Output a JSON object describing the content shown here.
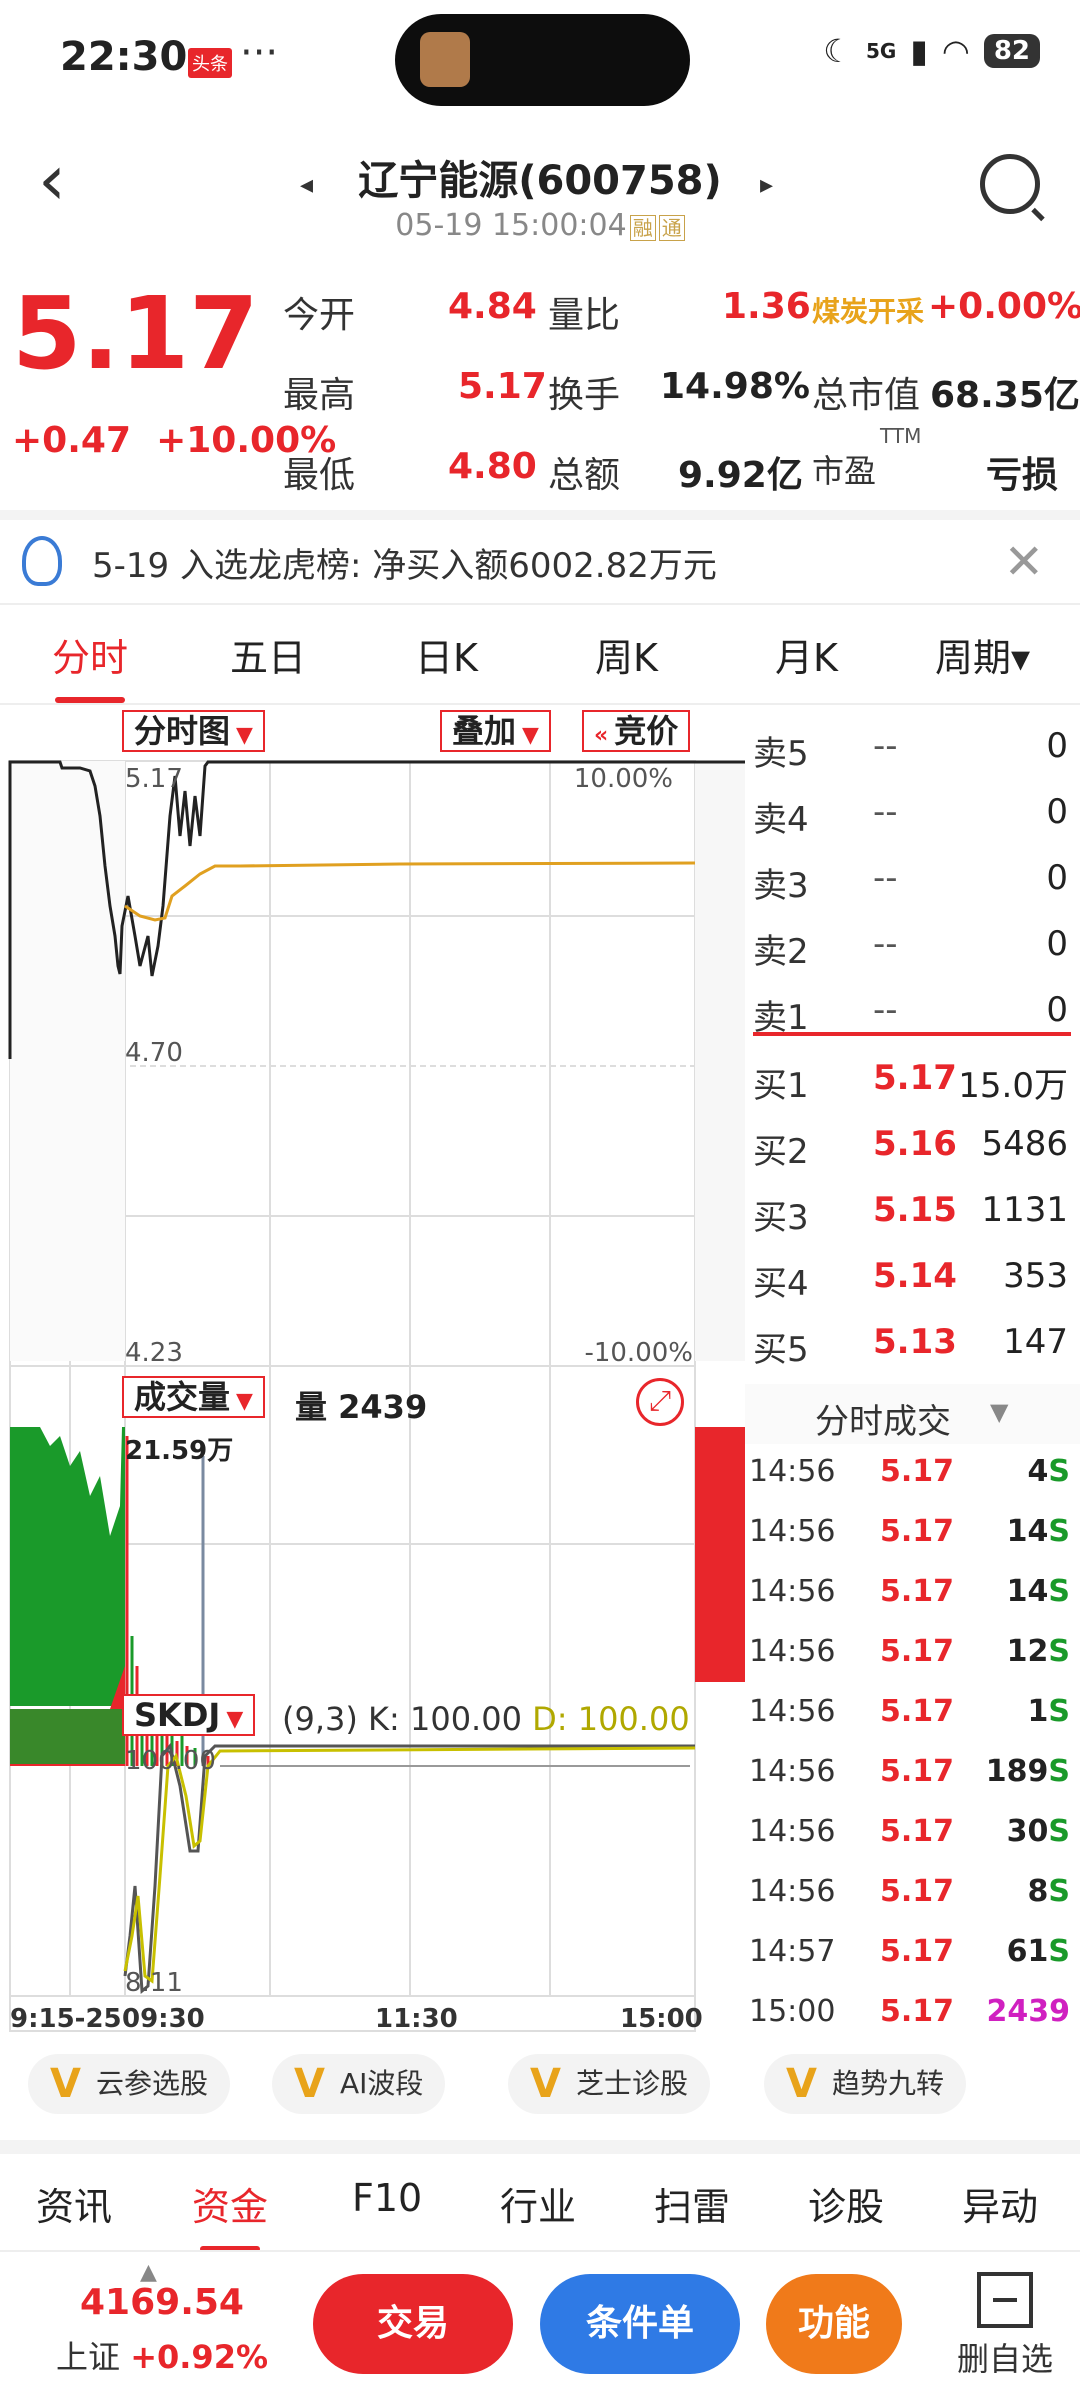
{
  "status_bar": {
    "time": "22:30",
    "badge": "头条",
    "dots": "···",
    "network": "5G",
    "battery": "82"
  },
  "header": {
    "title": "辽宁能源(600758)",
    "subtitle": "05-19 15:00:04",
    "tag1": "融",
    "tag2": "通"
  },
  "quote": {
    "price": "5.17",
    "change": "+0.47",
    "change_pct": "+10.00%",
    "rows": [
      [
        {
          "label": "今开",
          "value": "4.84"
        },
        {
          "label": "量比",
          "value": "1.36"
        },
        {
          "label": "煤炭开采",
          "value": "+0.00%"
        }
      ],
      [
        {
          "label": "最高",
          "value": "5.17"
        },
        {
          "label": "换手",
          "value": "14.98%"
        },
        {
          "label": "总市值",
          "value": "68.35亿"
        }
      ],
      [
        {
          "label": "最低",
          "value": "4.80"
        },
        {
          "label": "总额",
          "value": "9.92亿"
        },
        {
          "label": "市盈",
          "sup": "TTM",
          "value": "亏损"
        }
      ]
    ]
  },
  "notice": {
    "text": "5-19 入选龙虎榜: 净买入额6002.82万元"
  },
  "tabs": [
    "分时",
    "五日",
    "日K",
    "周K",
    "月K",
    "周期▾"
  ],
  "chart": {
    "dropdown_main": "分时图",
    "dropdown_overlay": "叠加",
    "auction": "竞价",
    "price_top": "5.17",
    "price_mid": "4.70",
    "price_bottom": "4.23",
    "pct_top": "10.00%",
    "pct_bottom": "-10.00%",
    "volume_dropdown": "成交量",
    "volume_label": "量 2439",
    "volume_max": "21.59万",
    "kdj_dropdown": "SKDJ",
    "kdj_params": "(9,3)",
    "kdj_k": "K: 100.00",
    "kdj_d": "D: 100.00",
    "kdj_top": "100.00",
    "kdj_bottom": "8.11",
    "time_labels": [
      "9:15-25",
      "09:30",
      "11:30",
      "15:00"
    ]
  },
  "order_book": {
    "sell": [
      {
        "label": "卖5",
        "price": "--",
        "vol": "0"
      },
      {
        "label": "卖4",
        "price": "--",
        "vol": "0"
      },
      {
        "label": "卖3",
        "price": "--",
        "vol": "0"
      },
      {
        "label": "卖2",
        "price": "--",
        "vol": "0"
      },
      {
        "label": "卖1",
        "price": "--",
        "vol": "0"
      }
    ],
    "buy": [
      {
        "label": "买1",
        "price": "5.17",
        "vol": "15.0万"
      },
      {
        "label": "买2",
        "price": "5.16",
        "vol": "5486"
      },
      {
        "label": "买3",
        "price": "5.15",
        "vol": "1131"
      },
      {
        "label": "买4",
        "price": "5.14",
        "vol": "353"
      },
      {
        "label": "买5",
        "price": "5.13",
        "vol": "147"
      }
    ]
  },
  "ticks": {
    "title": "分时成交",
    "rows": [
      {
        "time": "14:56",
        "price": "5.17",
        "vol": "4",
        "side": "S"
      },
      {
        "time": "14:56",
        "price": "5.17",
        "vol": "14",
        "side": "S"
      },
      {
        "time": "14:56",
        "price": "5.17",
        "vol": "14",
        "side": "S"
      },
      {
        "time": "14:56",
        "price": "5.17",
        "vol": "12",
        "side": "S"
      },
      {
        "time": "14:56",
        "price": "5.17",
        "vol": "1",
        "side": "S"
      },
      {
        "time": "14:56",
        "price": "5.17",
        "vol": "189",
        "side": "S"
      },
      {
        "time": "14:56",
        "price": "5.17",
        "vol": "30",
        "side": "S"
      },
      {
        "time": "14:56",
        "price": "5.17",
        "vol": "8",
        "side": "S"
      },
      {
        "time": "14:57",
        "price": "5.17",
        "vol": "61",
        "side": "S"
      },
      {
        "time": "15:00",
        "price": "5.17",
        "vol": "2439",
        "side": ""
      }
    ]
  },
  "tools": [
    "云参选股",
    "AI波段",
    "芝士诊股",
    "趋势九转"
  ],
  "bottom_nav": [
    "资讯",
    "资金",
    "F10",
    "行业",
    "扫雷",
    "诊股",
    "异动"
  ],
  "footer": {
    "index_value": "4169.54",
    "index_name": "上证",
    "index_change": "+0.92%",
    "trade": "交易",
    "condition": "条件单",
    "function": "功能",
    "fav": "删自选"
  },
  "colors": {
    "up": "#e8262b",
    "down": "#1a9a2a",
    "avg_line": "#e0a020",
    "kdj_d": "#c8c000"
  }
}
